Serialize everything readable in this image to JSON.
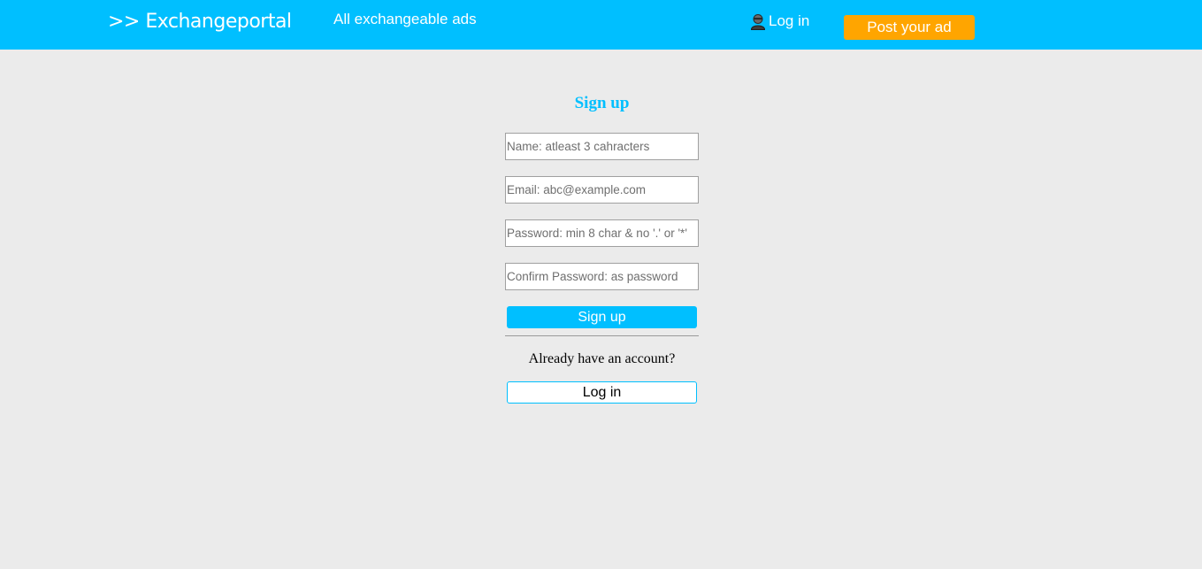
{
  "navbar": {
    "brand": ">> Exchangeportal",
    "all_ads_link": "All exchangeable ads",
    "login_link": "Log in",
    "login_icon": "user-icon",
    "post_ad_button": "Post your ad"
  },
  "signup_form": {
    "title": "Sign up",
    "name_placeholder": "Name: atleast 3 cahracters",
    "email_placeholder": "Email: abc@example.com",
    "password_placeholder": "Password: min 8 char & no '.' or '*'",
    "confirm_password_placeholder": "Confirm Password: as password",
    "submit_button": "Sign up",
    "already_text": "Already have an account?",
    "login_button": "Log in"
  },
  "colors": {
    "accent": "#00bfff",
    "post_button": "#ffa500",
    "background": "#ebebeb"
  }
}
